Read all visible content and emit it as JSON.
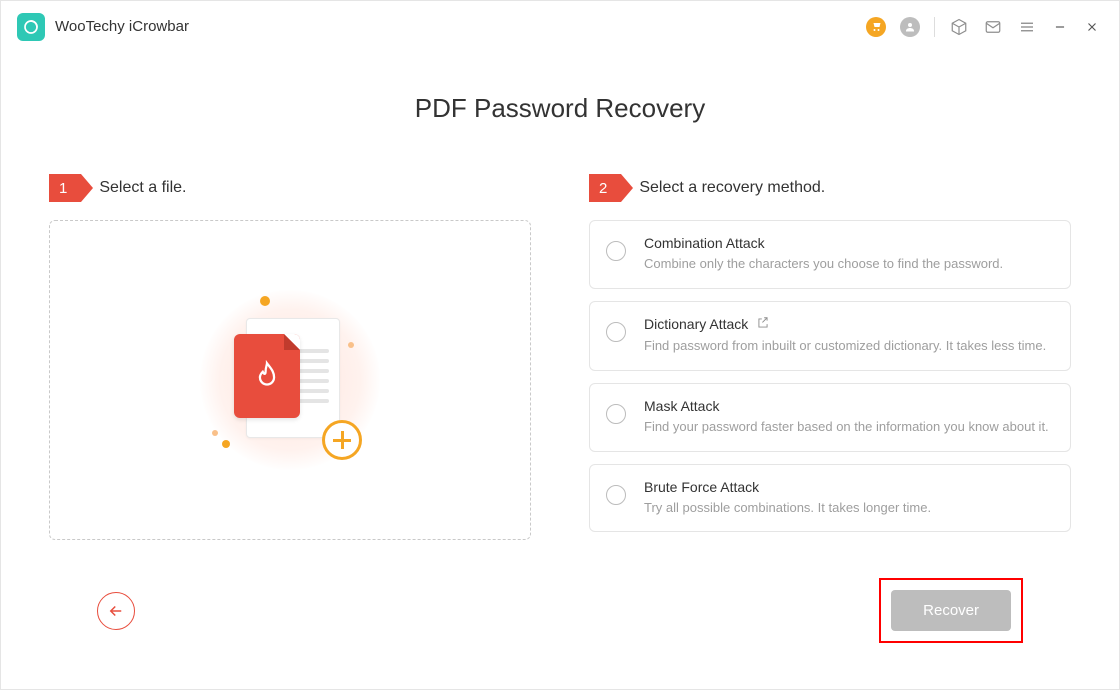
{
  "app": {
    "title": "WooTechy iCrowbar"
  },
  "page": {
    "title": "PDF Password Recovery"
  },
  "steps": {
    "one": {
      "number": "1",
      "label": "Select a file."
    },
    "two": {
      "number": "2",
      "label": "Select a recovery method."
    }
  },
  "methods": [
    {
      "title": "Combination Attack",
      "desc": "Combine only the characters you choose to find the password.",
      "has_import_icon": false
    },
    {
      "title": "Dictionary Attack",
      "desc": "Find password from inbuilt or customized dictionary. It takes less time.",
      "has_import_icon": true
    },
    {
      "title": "Mask Attack",
      "desc": "Find your password faster based on the information you know about it.",
      "has_import_icon": false
    },
    {
      "title": "Brute Force Attack",
      "desc": "Try all possible combinations. It takes longer time.",
      "has_import_icon": false
    }
  ],
  "footer": {
    "recover_label": "Recover"
  },
  "icons": {
    "cart": "cart-icon",
    "user": "user-icon",
    "cube": "cube-icon",
    "mail": "mail-icon",
    "menu": "menu-icon",
    "minimize": "minimize-icon",
    "close": "close-icon",
    "back": "back-arrow-icon",
    "plus": "plus-icon",
    "import": "import-icon"
  },
  "colors": {
    "accent_red": "#e84d3d",
    "accent_teal": "#2EC8B5",
    "accent_orange": "#f5a623",
    "highlight_box": "#ff0000",
    "disabled_gray": "#bdbdbd"
  }
}
